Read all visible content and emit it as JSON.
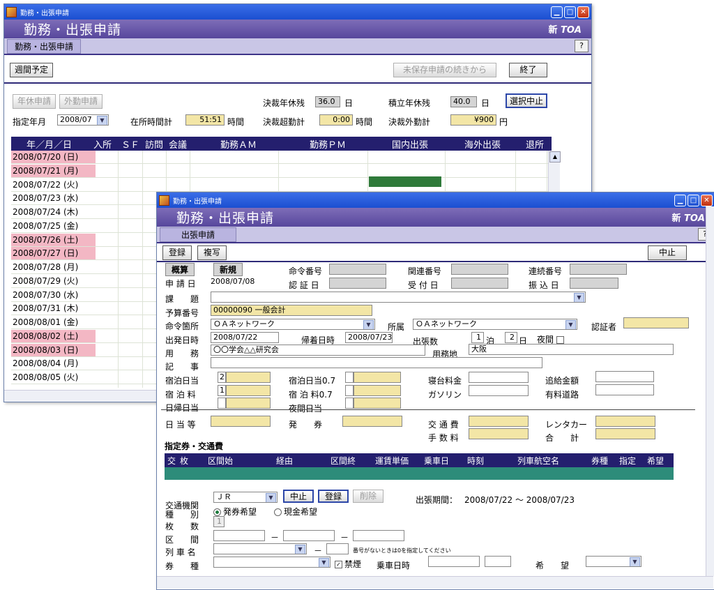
{
  "back": {
    "titlebar": "勤務・出張申請",
    "banner_title": "勤務・出張申請",
    "brand_prefix": "新",
    "brand": "TOA",
    "tab": "勤務・出張申請",
    "help": "?",
    "weekly_btn": "週間予定",
    "unsaved_btn": "未保存申請の続きから",
    "exit_btn": "終了",
    "annual_leave_btn": "年休申請",
    "outside_work_btn": "外勤申請",
    "approved_leave_label": "決裁年休残",
    "approved_leave_value": "36.0",
    "approved_leave_unit": "日",
    "accum_leave_label": "積立年休残",
    "accum_leave_value": "40.0",
    "accum_leave_unit": "日",
    "cancel_sel_btn": "選択中止",
    "month_label": "指定年月",
    "month_value": "2008/07",
    "presence_label": "在所時間計",
    "presence_value": "51:51",
    "presence_unit": "時間",
    "overtime_label": "決裁超勤計",
    "overtime_value": "0:00",
    "overtime_unit": "時間",
    "outwork_label": "決裁外勤計",
    "outwork_value": "¥900",
    "outwork_unit": "円",
    "grid_headers": [
      "年／月／日",
      "入所",
      "ＳＦ",
      "訪問",
      "会議",
      "勤務ＡＭ",
      "勤務ＰＭ",
      "国内出張",
      "海外出張",
      "退所"
    ],
    "rows": [
      {
        "date": "2008/07/20 (日)",
        "holiday": true
      },
      {
        "date": "2008/07/21 (月)",
        "holiday": true
      },
      {
        "date": "2008/07/22 (火)",
        "holiday": false
      },
      {
        "date": "2008/07/23 (水)",
        "holiday": false
      },
      {
        "date": "2008/07/24 (木)",
        "holiday": false
      },
      {
        "date": "2008/07/25 (金)",
        "holiday": false
      },
      {
        "date": "2008/07/26 (土)",
        "holiday": true
      },
      {
        "date": "2008/07/27 (日)",
        "holiday": true
      },
      {
        "date": "2008/07/28 (月)",
        "holiday": false
      },
      {
        "date": "2008/07/29 (火)",
        "holiday": false
      },
      {
        "date": "2008/07/30 (水)",
        "holiday": false
      },
      {
        "date": "2008/07/31 (木)",
        "holiday": false
      },
      {
        "date": "2008/08/01 (金)",
        "holiday": false
      },
      {
        "date": "2008/08/02 (土)",
        "holiday": true
      },
      {
        "date": "2008/08/03 (日)",
        "holiday": true
      },
      {
        "date": "2008/08/04 (月)",
        "holiday": false
      },
      {
        "date": "2008/08/05 (火)",
        "holiday": false
      }
    ],
    "trip_fill_color": "#2f7a3a"
  },
  "front": {
    "titlebar": "勤務・出張申請",
    "banner_title": "勤務・出張申請",
    "brand_prefix": "新",
    "brand": "TOA",
    "tab": "出張申請",
    "help": "?",
    "register_btn": "登録",
    "copy_btn": "複写",
    "cancel_btn": "中止",
    "estimate_tag": "概算",
    "new_tag": "新規",
    "order_no_label": "命令番号",
    "related_no_label": "関連番号",
    "serial_no_label": "連続番号",
    "apply_date_label": "申 請 日",
    "apply_date_value": "2008/07/08",
    "approve_date_label": "認 証 日",
    "receive_date_label": "受 付 日",
    "transfer_date_label": "振 込 日",
    "section_label": "課　　題",
    "budget_label": "予算番号",
    "budget_value": "00000090 一般会計",
    "order_place_label": "命令箇所",
    "order_place_value": "ＯＡネットワーク",
    "affiliation_label": "所属",
    "affiliation_value": "ＯＡネットワーク",
    "certifier_label": "認証者",
    "depart_label": "出発日時",
    "depart_value": "2008/07/22",
    "return_label": "帰着日時",
    "return_value": "2008/07/23",
    "trip_days_label": "出張数",
    "nights_value": "1",
    "nights_unit": "泊",
    "days_value": "2",
    "days_unit": "日",
    "night_label": "夜間",
    "purpose_label": "用　　務",
    "purpose_value": "〇〇学会△△研究会",
    "destination_label": "用務地",
    "destination_value": "大阪",
    "notes_label": "記　　事",
    "lodging_allow_label": "宿泊日当",
    "lodging_allow_value": "2",
    "lodging_allow07_label": "宿泊日当0.7",
    "sleeper_label": "寝台料金",
    "extra_pay_label": "追給金額",
    "lodging_fee_label": "宿 泊 料",
    "lodging_fee_value": "1",
    "lodging_fee07_label": "宿 泊 料0.7",
    "gasoline_label": "ガソリン",
    "toll_label": "有料道路",
    "dayreturn_label": "日帰日当",
    "night_allow_label": "夜間日当",
    "daily_label": "日 当 等",
    "ticket_label": "発　　券",
    "transport_label": "交 通 費",
    "rental_label": "レンタカー",
    "fee_label": "手 数 料",
    "total_label": "合　　計",
    "section_title": "指定券・交通費",
    "table_headers": [
      "交",
      "枚",
      "区間始",
      "経由",
      "区間終",
      "運賃単価",
      "乗車日",
      "時刻",
      "列車航空名",
      "券種",
      "指定",
      "希望"
    ],
    "transit_label": "交通機関",
    "transit_value": "ＪＲ",
    "transit_cancel_btn": "中止",
    "transit_register_btn": "登録",
    "transit_delete_btn": "削除",
    "trip_period_label": "出張期間：",
    "trip_period_value": "2008/07/22 ～ 2008/07/23",
    "type_label": "種　　別",
    "type_option1": "発券希望",
    "type_option2": "現金希望",
    "count_label": "枚　　数",
    "count_value": "1",
    "segment_label": "区　　間",
    "dash": "－",
    "train_label": "列 車 名",
    "train_note": "番号がないときは0を指定してください",
    "ticket_type_label": "券　　種",
    "nonsmoking_label": "禁煙",
    "board_time_label": "乗車日時",
    "wish_label": "希　　望"
  }
}
